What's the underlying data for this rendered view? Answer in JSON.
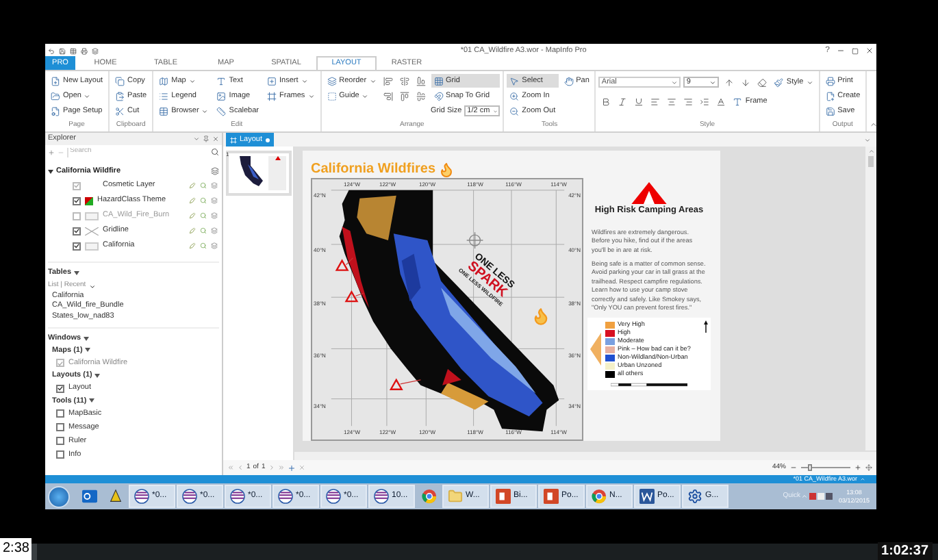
{
  "window": {
    "title": "*01 CA_Wildfire A3.wor - MapInfo Pro",
    "help": "?"
  },
  "tabs": [
    {
      "label": "PRO",
      "selected": false,
      "kind": "file"
    },
    {
      "label": "HOME",
      "selected": false,
      "kind": "tab"
    },
    {
      "label": "TABLE",
      "selected": false,
      "kind": "tab"
    },
    {
      "label": "MAP",
      "selected": false,
      "kind": "tab"
    },
    {
      "label": "SPATIAL",
      "selected": false,
      "kind": "tab"
    },
    {
      "label": "LAYOUT",
      "selected": true,
      "kind": "tab"
    },
    {
      "label": "RASTER",
      "selected": false,
      "kind": "tab"
    }
  ],
  "ribbon": [
    {
      "label": "Page",
      "kind": "columns",
      "columns": [
        [
          {
            "kind": "button",
            "label": "New Layout",
            "dropdown": false,
            "on": false
          },
          {
            "kind": "button",
            "label": "Open",
            "dropdown": true,
            "on": false
          },
          {
            "kind": "button",
            "label": "Page Setup",
            "dropdown": false,
            "on": false
          }
        ]
      ]
    },
    {
      "label": "Clipboard",
      "kind": "columns",
      "columns": [
        [
          {
            "kind": "button",
            "label": "Copy",
            "dropdown": false,
            "on": false
          },
          {
            "kind": "button",
            "label": "Paste",
            "dropdown": false,
            "on": false
          },
          {
            "kind": "button",
            "label": "Cut",
            "dropdown": false,
            "on": false
          }
        ]
      ]
    },
    {
      "label": "Edit",
      "kind": "columns",
      "columns": [
        [
          {
            "kind": "button",
            "label": "Map",
            "dropdown": true,
            "on": false
          },
          {
            "kind": "button",
            "label": "Legend",
            "dropdown": false,
            "on": false
          },
          {
            "kind": "button",
            "label": "Browser",
            "dropdown": true,
            "on": false
          }
        ],
        [
          {
            "kind": "button",
            "label": "Text",
            "dropdown": false,
            "on": false
          },
          {
            "kind": "button",
            "label": "Image",
            "dropdown": false,
            "on": false
          },
          {
            "kind": "button",
            "label": "Scalebar",
            "dropdown": false,
            "on": false
          }
        ],
        [
          {
            "kind": "button",
            "label": "Insert",
            "dropdown": true,
            "on": false
          },
          {
            "kind": "button",
            "label": "Frames",
            "dropdown": true,
            "on": false
          }
        ]
      ]
    },
    {
      "label": "Arrange",
      "kind": "columns",
      "columns": [
        [
          {
            "kind": "button",
            "label": "Reorder",
            "dropdown": true,
            "on": false
          },
          {
            "kind": "button",
            "label": "Guide",
            "dropdown": true,
            "on": false
          }
        ],
        [
          {
            "kind": "icon",
            "on": false
          },
          {
            "kind": "icon",
            "on": false
          }
        ],
        [
          {
            "kind": "icon",
            "on": false
          },
          {
            "kind": "icon",
            "on": false
          }
        ],
        [
          {
            "kind": "icon",
            "on": false
          },
          {
            "kind": "icon",
            "on": false
          }
        ],
        [
          {
            "kind": "button",
            "label": "Grid",
            "dropdown": false,
            "on": true
          },
          {
            "kind": "button",
            "label": "Snap To Grid",
            "dropdown": false,
            "on": false
          },
          {
            "kind": "field",
            "label": "Grid Size",
            "value": "1/2 cm"
          }
        ]
      ]
    },
    {
      "label": "Tools",
      "kind": "columns",
      "columns": [
        [
          {
            "kind": "button",
            "label": "Select",
            "dropdown": false,
            "on": true
          },
          {
            "kind": "button",
            "label": "Zoom In",
            "dropdown": false,
            "on": false
          },
          {
            "kind": "button",
            "label": "Zoom Out",
            "dropdown": false,
            "on": false
          }
        ],
        [
          {
            "kind": "button",
            "label": "Pan",
            "dropdown": false,
            "on": false
          }
        ]
      ]
    },
    {
      "label": "Style",
      "kind": "rows",
      "columns": [
        [
          {
            "kind": "field_wide",
            "value": "Arial"
          },
          {
            "kind": "field",
            "value": "9"
          },
          {
            "kind": "icon",
            "on": false
          },
          {
            "kind": "icon",
            "on": false
          },
          {
            "kind": "icon",
            "on": false
          },
          {
            "kind": "button",
            "label": "Style",
            "dropdown": true,
            "on": false
          }
        ],
        [
          {
            "kind": "icon",
            "on": false
          },
          {
            "kind": "icon",
            "on": false
          },
          {
            "kind": "icon",
            "on": false
          },
          {
            "kind": "icon",
            "on": false
          },
          {
            "kind": "icon",
            "on": false
          },
          {
            "kind": "icon",
            "on": false
          },
          {
            "kind": "icon",
            "on": false
          },
          {
            "kind": "icon",
            "on": false
          },
          {
            "kind": "button",
            "label": "Frame",
            "dropdown": false,
            "on": false
          }
        ]
      ]
    },
    {
      "label": "Output",
      "kind": "columns",
      "columns": [
        [
          {
            "kind": "button",
            "label": "Print",
            "dropdown": false,
            "on": false
          },
          {
            "kind": "button",
            "label": "Create",
            "dropdown": false,
            "on": false
          },
          {
            "kind": "button",
            "label": "Save",
            "dropdown": false,
            "on": false
          }
        ]
      ]
    }
  ],
  "explorer": {
    "title": "Explorer",
    "search_placeholder": "Search",
    "map": {
      "name": "California Wildfire",
      "expanded": true,
      "layers": [
        {
          "name": "Cosmetic Layer",
          "checked": true,
          "disabled": true
        },
        {
          "name": "HazardClass Theme",
          "checked": true,
          "disabled": false
        },
        {
          "name": "CA_Wild_Fire_Burn",
          "checked": false,
          "disabled": true
        },
        {
          "name": "Gridline",
          "checked": true,
          "disabled": false
        },
        {
          "name": "California",
          "checked": true,
          "disabled": false
        }
      ]
    },
    "tables": {
      "heading": "Tables",
      "filter": "List | Recent",
      "items": [
        "California",
        "CA_Wild_fire_Bundle",
        "States_low_nad83"
      ]
    },
    "windows": {
      "heading": "Windows",
      "groups": [
        {
          "label": "Maps (1)",
          "items": [
            {
              "name": "California Wildfire",
              "checked": true,
              "disabled": true
            }
          ]
        },
        {
          "label": "Layouts (1)",
          "items": [
            {
              "name": "Layout",
              "checked": true,
              "disabled": false
            }
          ]
        },
        {
          "label": "Tools (11)",
          "items": [
            {
              "name": "MapBasic",
              "checked": false,
              "disabled": false
            },
            {
              "name": "Message",
              "checked": false,
              "disabled": false
            },
            {
              "name": "Ruler",
              "checked": false,
              "disabled": false
            },
            {
              "name": "Info",
              "checked": false,
              "disabled": false
            }
          ]
        }
      ]
    }
  },
  "layout_window": {
    "tab": "Layout",
    "page_number": "1",
    "page": {
      "title": "California Wildfires",
      "map": {
        "top_ticks": [
          "124°W",
          "122°W",
          "120°W",
          "118°W",
          "116°W",
          "114°W"
        ],
        "bottom_ticks": [
          "124°W",
          "122°W",
          "120°W",
          "118°W",
          "116°W",
          "114°W"
        ],
        "left_ticks": [
          "42°N",
          "40°N",
          "38°N",
          "36°N",
          "34°N"
        ],
        "right_ticks": [
          "42°N",
          "40°N",
          "38°N",
          "36°N",
          "34°N"
        ],
        "logo": [
          "ONE LESS",
          "SPARK",
          "ONE LESS WILDFIRE"
        ]
      },
      "panel": {
        "heading": "High Risk Camping Areas",
        "paragraphs": [
          "Wildfires are extremely dangerous. Before you hike, find out if the areas you'll be in are at risk.",
          "Being safe is a matter of common sense. Avoid parking your car in tall grass at the trailhead. Respect campfire regulations. Learn how to use your camp stove correctly and safely. Like Smokey says, \"Only YOU can prevent forest fires.\""
        ],
        "legend": [
          {
            "label": "Very High",
            "color": "#f0a040"
          },
          {
            "label": "High",
            "color": "#d81020"
          },
          {
            "label": "Moderate",
            "color": "#7aa0e0"
          },
          {
            "label": "Pink – How bad can it be?",
            "color": "#e8b0a0"
          },
          {
            "label": "Non-Wildland/Non-Urban",
            "color": "#2050d0"
          },
          {
            "label": "Urban Unzoned",
            "color": "#f4f0c8"
          },
          {
            "label": "all others",
            "color": "#000000"
          }
        ]
      }
    },
    "navigation": {
      "current": "1",
      "of": "of",
      "total": "1"
    },
    "zoom": "44%",
    "zoom_slider": {
      "level": 0.15
    }
  },
  "status_bar": {
    "text": "*01 CA_Wildfire A3.wor"
  },
  "taskbar": {
    "items": [
      {
        "kind": "outlook"
      },
      {
        "kind": "app"
      },
      {
        "kind": "mapinfo",
        "label": "*0..."
      },
      {
        "kind": "mapinfo",
        "label": "*0..."
      },
      {
        "kind": "mapinfo",
        "label": "*0..."
      },
      {
        "kind": "mapinfo",
        "label": "*0..."
      },
      {
        "kind": "mapinfo",
        "label": "*0..."
      },
      {
        "kind": "mapinfo",
        "label": "10..."
      },
      {
        "kind": "chrome"
      },
      {
        "kind": "folder",
        "label": "W..."
      },
      {
        "kind": "powerpoint",
        "label": "Bi..."
      },
      {
        "kind": "powerpoint",
        "label": "Po..."
      },
      {
        "kind": "chrome",
        "label": "N..."
      },
      {
        "kind": "word",
        "label": "Po..."
      },
      {
        "kind": "gear",
        "label": "G..."
      }
    ],
    "quick": "Quick",
    "time": "13:08",
    "date": "03/12/2015"
  },
  "video": {
    "elapsed": "2:38",
    "duration": "1:02:37",
    "level": 0.04
  }
}
